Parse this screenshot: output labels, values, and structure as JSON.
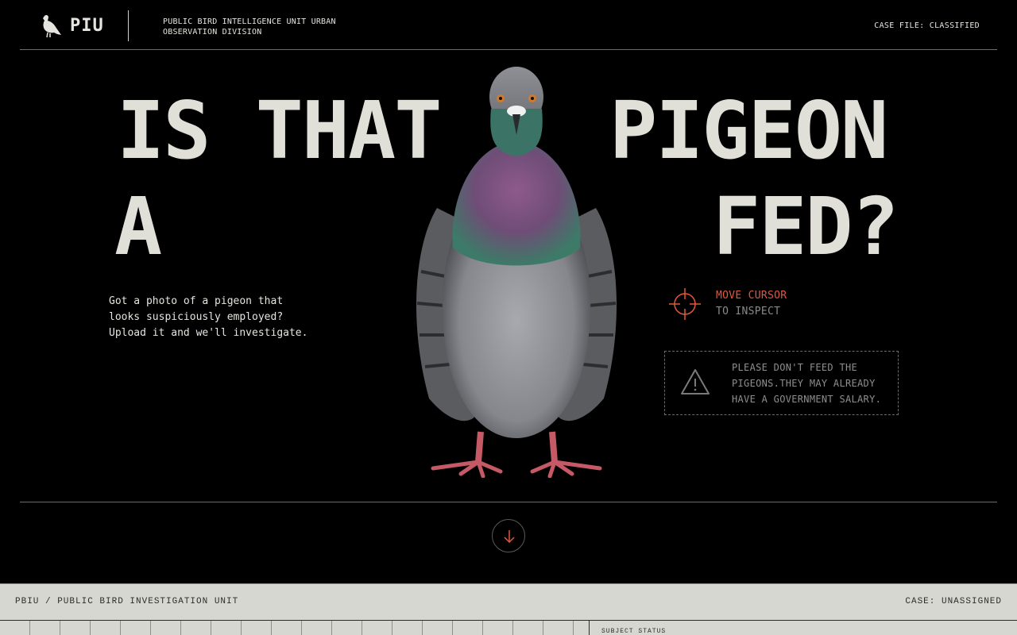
{
  "header": {
    "logo_text": "PIU",
    "logo_icon": "pigeon-icon",
    "description": "PUBLIC BIRD INTELLIGENCE UNIT URBAN OBSERVATION DIVISION",
    "case_file": "CASE FILE: CLASSIFIED"
  },
  "hero": {
    "line1_left": "IS THAT",
    "line1_right": "PIGEON",
    "line2_left": "A",
    "line2_right": "FED?",
    "intro_line1": "Got a photo of a pigeon that",
    "intro_line2": "looks suspiciously employed?",
    "intro_line3": "Upload it and we'll investigate."
  },
  "inspect": {
    "icon": "crosshair-icon",
    "action": "MOVE CURSOR",
    "hint": "TO INSPECT"
  },
  "warning": {
    "icon": "warning-triangle-icon",
    "line1": "PLEASE DON'T FEED THE",
    "line2": "PIGEONS.THEY MAY ALREADY",
    "line3": "HAVE A GOVERNMENT SALARY."
  },
  "scroll": {
    "icon": "arrow-down-icon"
  },
  "case_bar": {
    "left": "PBIU / PUBLIC BIRD INVESTIGATION UNIT",
    "right": "CASE: UNASSIGNED",
    "subject_status_label": "SUBJECT STATUS"
  },
  "colors": {
    "background": "#000000",
    "headline": "#e1e0d8",
    "accent": "#e3573c",
    "muted": "#8e8e8e",
    "panel": "#d7d7d1"
  }
}
